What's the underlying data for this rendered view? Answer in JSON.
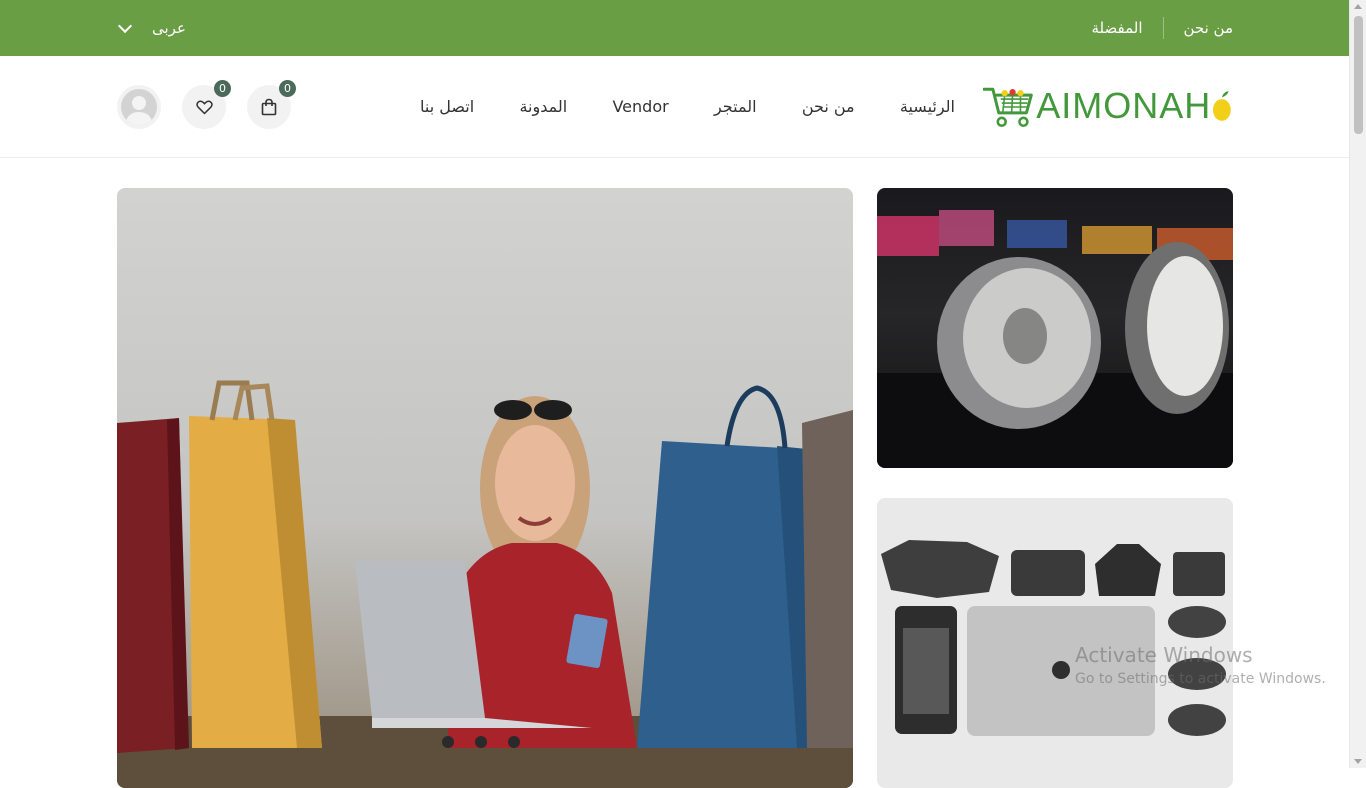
{
  "topbar": {
    "language": "عربى",
    "links": [
      "من نحن",
      "المفضلة"
    ]
  },
  "header": {
    "logo_text": "AIMONAH",
    "nav": [
      "الرئيسية",
      "من نحن",
      "المتجر",
      "Vendor",
      "المدونة",
      "اتصل بنا"
    ],
    "cart_count": "0",
    "wishlist_count": "0"
  },
  "slider": {
    "slide_count": 3
  },
  "icons": {
    "cart": "shopping-bag-icon",
    "wishlist": "heart-icon",
    "account": "user-avatar-icon",
    "language": "chevron-down-icon"
  },
  "colors": {
    "brand_green": "#6a9e45",
    "logo_green": "#42983b",
    "badge": "#4b6a5a",
    "lemon": "#f2d019"
  },
  "watermark": {
    "line1": "Activate Windows",
    "line2": "Go to Settings to activate Windows."
  }
}
